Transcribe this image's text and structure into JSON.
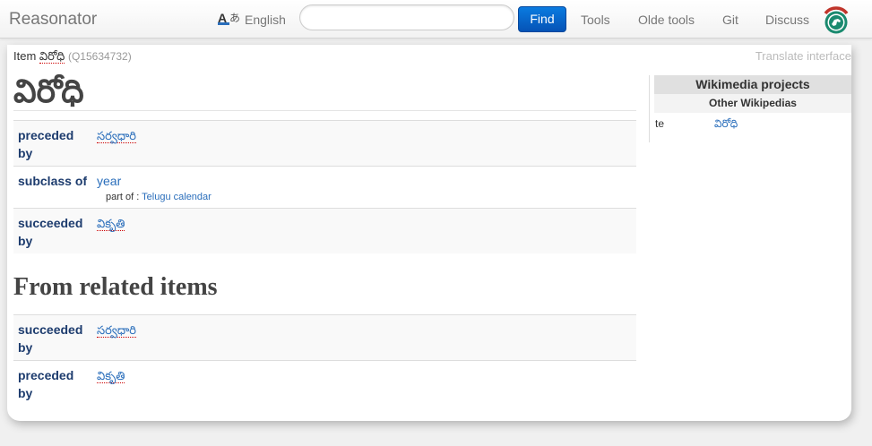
{
  "navbar": {
    "brand": "Reasonator",
    "language_icon": "translate-icon",
    "language": "English",
    "search_placeholder": "",
    "find_label": "Find",
    "links": [
      "Tools",
      "Olde tools",
      "Git",
      "Discuss"
    ],
    "logo": "wikimedia-toolforge-logo",
    "find_color": "#0a6fd6"
  },
  "item": {
    "prefix": "Item",
    "label": "విరోధి",
    "qid": "(Q15634732)",
    "translate_link": "Translate interface",
    "title": "విరోధి"
  },
  "properties": [
    {
      "name": "preceded by",
      "value": "సర్వధారి"
    },
    {
      "name": "subclass of",
      "value": "year",
      "qualifier_label": "part of :",
      "qualifier_value": "Telugu calendar"
    },
    {
      "name": "succeeded by",
      "value": "వికృతి"
    }
  ],
  "related": {
    "heading": "From related items",
    "properties": [
      {
        "name": "succeeded by",
        "value": "సర్వధారి"
      },
      {
        "name": "preceded by",
        "value": "వికృతి"
      }
    ]
  },
  "sidebar": {
    "heading": "Wikimedia projects",
    "subheading": "Other Wikipedias",
    "wikis": [
      {
        "code": "te",
        "title": "విరోధి"
      }
    ]
  }
}
